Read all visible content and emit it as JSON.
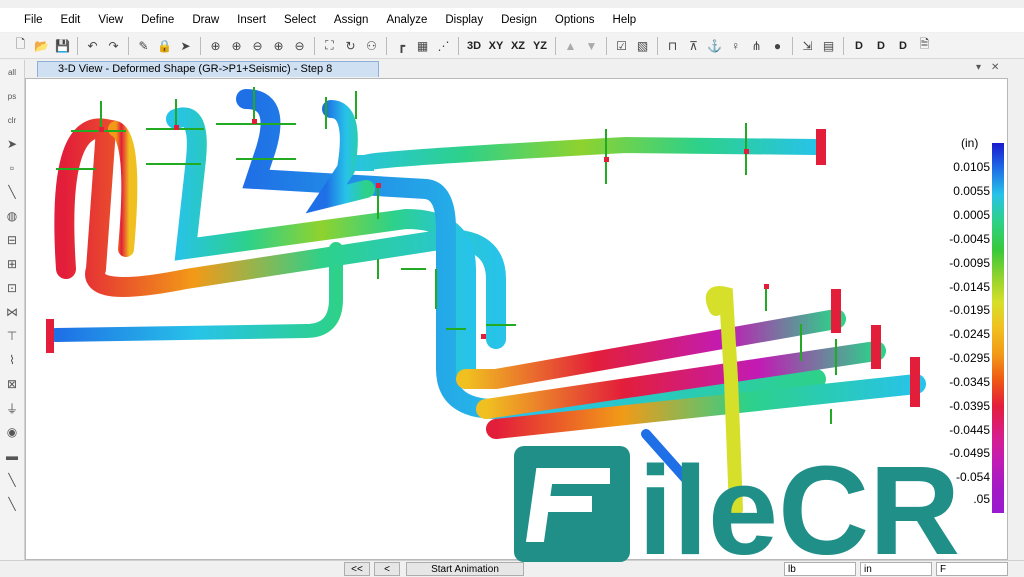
{
  "menu": [
    "File",
    "Edit",
    "View",
    "Define",
    "Draw",
    "Insert",
    "Select",
    "Assign",
    "Analyze",
    "Display",
    "Design",
    "Options",
    "Help"
  ],
  "toolbar": {
    "view_labels": [
      "3D",
      "XY",
      "XZ",
      "YZ"
    ],
    "design_labels": [
      "D",
      "D",
      "D"
    ]
  },
  "left_toolbar": {
    "labels": [
      "all",
      "ps",
      "clr"
    ]
  },
  "tab": {
    "title": "3-D View - Deformed Shape (GR->P1+Seismic) - Step 8",
    "controls": [
      "▾",
      "✕"
    ]
  },
  "legend": {
    "unit": "(in)",
    "values": [
      "0.0105",
      "0.0055",
      "0.0005",
      "-0.0045",
      "-0.0095",
      "-0.0145",
      "-0.0195",
      "-0.0245",
      "-0.0295",
      "-0.0345",
      "-0.0395",
      "-0.0445",
      "-0.0495",
      "-0.054",
      ".05"
    ],
    "colors": [
      "#1a1acc",
      "#1f6fe6",
      "#27c3e8",
      "#2dd18a",
      "#39c93a",
      "#8fd22e",
      "#d6df2a",
      "#f0c020",
      "#f29a17",
      "#ef5a14",
      "#e31e3a",
      "#d81e8a",
      "#c21bb5",
      "#a31ac4",
      "#9a1ad0"
    ]
  },
  "statusbar": {
    "first_button": "<<",
    "prev_button": "<",
    "animation_label": "Start Animation",
    "force_unit": "lb",
    "length_unit": "in",
    "temp_unit": "F"
  },
  "watermark": {
    "text": "FileCR"
  }
}
